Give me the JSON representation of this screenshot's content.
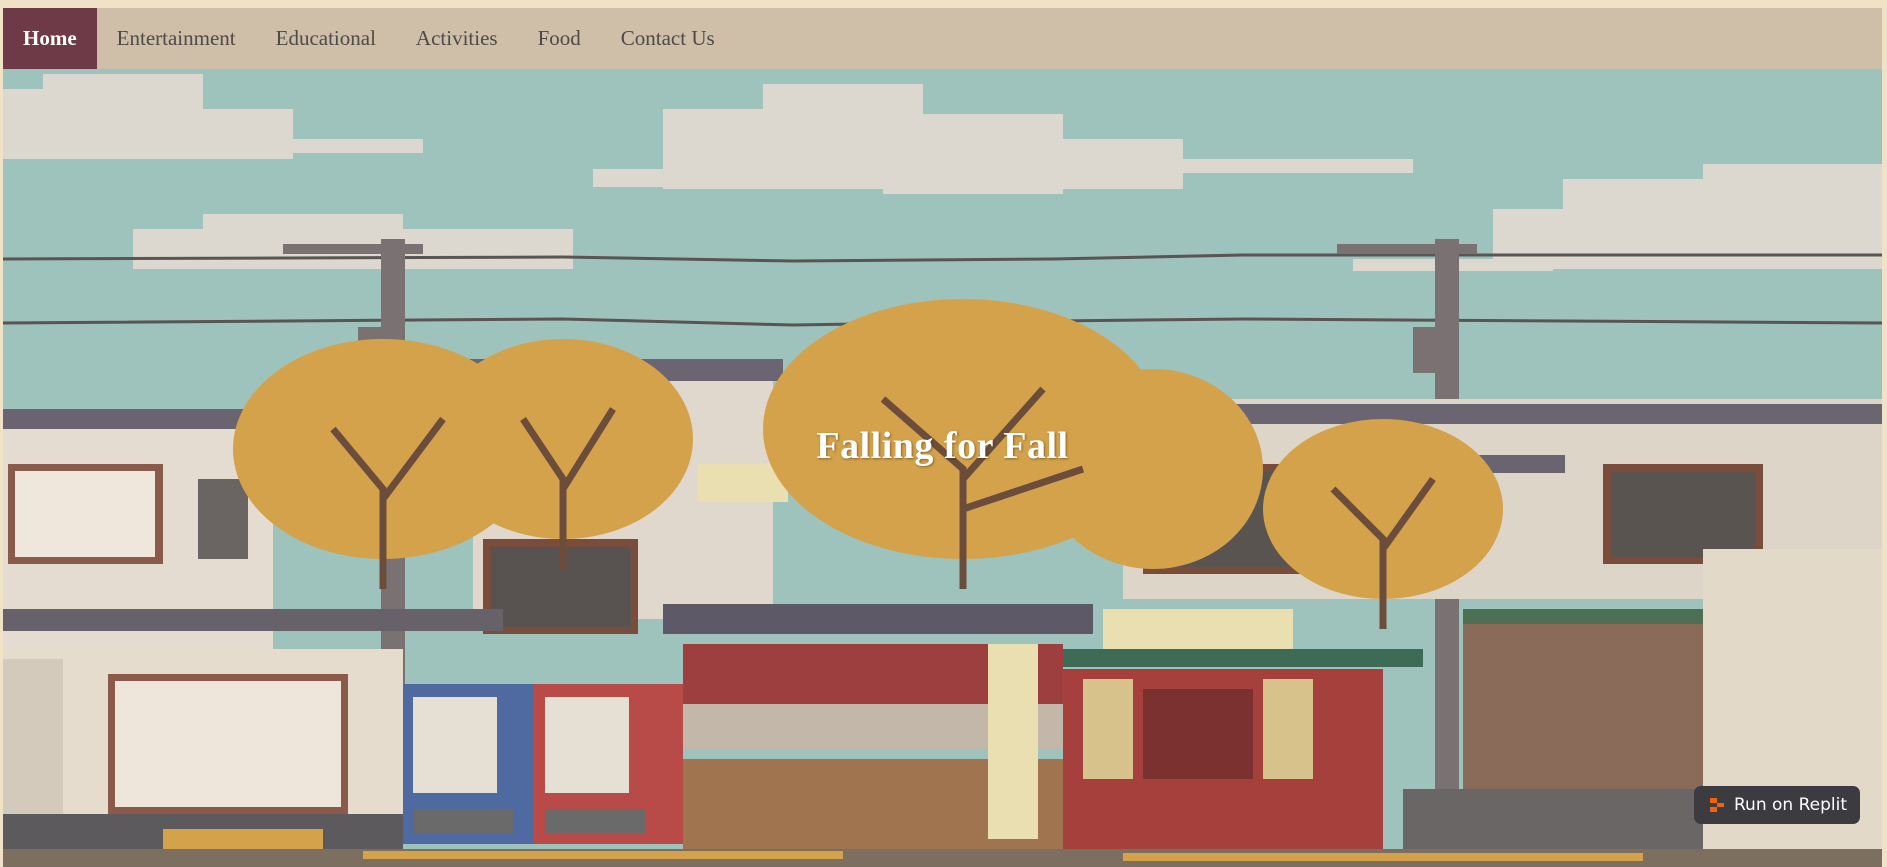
{
  "nav": {
    "items": [
      {
        "label": "Home",
        "active": true
      },
      {
        "label": "Entertainment",
        "active": false
      },
      {
        "label": "Educational",
        "active": false
      },
      {
        "label": "Activities",
        "active": false
      },
      {
        "label": "Food",
        "active": false
      },
      {
        "label": "Contact Us",
        "active": false
      }
    ]
  },
  "hero": {
    "title": "Falling for Fall",
    "image": "pixel-art-autumn-japanese-street-scene"
  },
  "replit_button": {
    "label": "Run on Replit",
    "icon": "replit-icon"
  },
  "colors": {
    "page_background": "#efe2c6",
    "nav_background": "#cfbfa9",
    "nav_active": "#6e3a47",
    "nav_text": "#4d4a49",
    "sky": "#9ec2bc",
    "button_background": "#3b3b40",
    "replit_orange": "#f26207"
  }
}
